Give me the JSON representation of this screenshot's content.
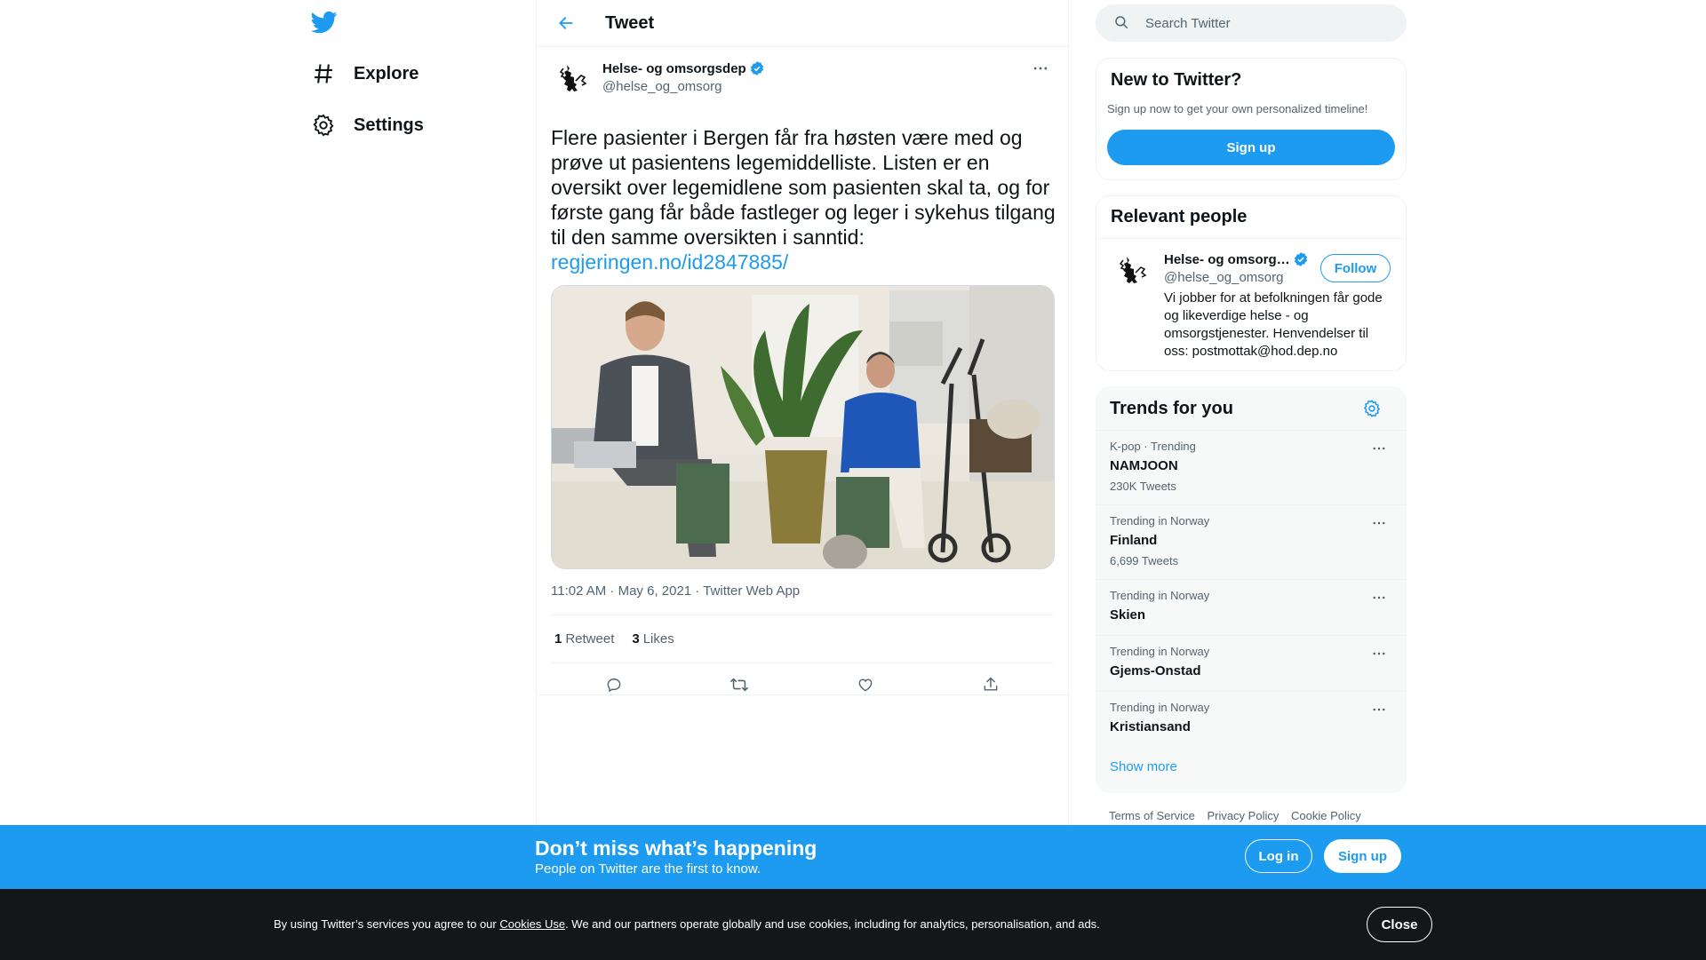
{
  "colors": {
    "accent": "#1d9bf0",
    "text": "#0f1419",
    "muted": "#536471",
    "cookie_bg": "#14171a"
  },
  "nav": {
    "logo_icon": "twitter-bird-icon",
    "items": [
      {
        "label": "Explore",
        "icon": "hashtag-icon"
      },
      {
        "label": "Settings",
        "icon": "gear-icon"
      }
    ]
  },
  "header": {
    "title": "Tweet",
    "back_icon": "arrow-left-icon"
  },
  "tweet": {
    "author_name": "Helse- og omsorgsdep",
    "handle": "@helse_og_omsorg",
    "text": "Flere pasienter i Bergen får fra høsten være med og prøve ut pasientens legemiddelliste. Listen er en oversikt over legemidlene som pasienten skal ta, og for første gang får både fastleger og leger i sykehus tilgang til den samme oversikten i sanntid:",
    "link": "regjeringen.no/id2847885/",
    "timestamp": "11:02 AM · May 6, 2021 · Twitter Web App",
    "retweets_count": "1",
    "retweets_label": "Retweet",
    "likes_count": "3",
    "likes_label": "Likes"
  },
  "search": {
    "placeholder": "Search Twitter"
  },
  "new_to_twitter": {
    "title": "New to Twitter?",
    "subtitle": "Sign up now to get your own personalized timeline!",
    "button": "Sign up"
  },
  "relevant_people": {
    "title": "Relevant people",
    "name": "Helse- og omsorg…",
    "handle": "@helse_og_omsorg",
    "follow": "Follow",
    "bio": "Vi jobber for at befolkningen får gode og likeverdige helse - og omsorgstjenester. Henvendelser til oss: postmottak@hod.dep.no"
  },
  "trends": {
    "title": "Trends for you",
    "items": [
      {
        "context": "K-pop · Trending",
        "name": "NAMJOON",
        "count": "230K Tweets"
      },
      {
        "context": "Trending in Norway",
        "name": "Finland",
        "count": "6,699 Tweets"
      },
      {
        "context": "Trending in Norway",
        "name": "Skien",
        "count": ""
      },
      {
        "context": "Trending in Norway",
        "name": "Gjems-Onstad",
        "count": ""
      },
      {
        "context": "Trending in Norway",
        "name": "Kristiansand",
        "count": ""
      }
    ],
    "show_more": "Show more"
  },
  "footer": {
    "terms": "Terms of Service",
    "privacy": "Privacy Policy",
    "cookie": "Cookie Policy"
  },
  "banner": {
    "title": "Don’t miss what’s happening",
    "subtitle": "People on Twitter are the first to know.",
    "login": "Log in",
    "signup": "Sign up"
  },
  "cookie": {
    "text_before": "By using Twitter’s services you agree to our ",
    "link": "Cookies Use",
    "text_after": ". We and our partners operate globally and use cookies, including for analytics, personalisation, and ads.",
    "close": "Close"
  }
}
